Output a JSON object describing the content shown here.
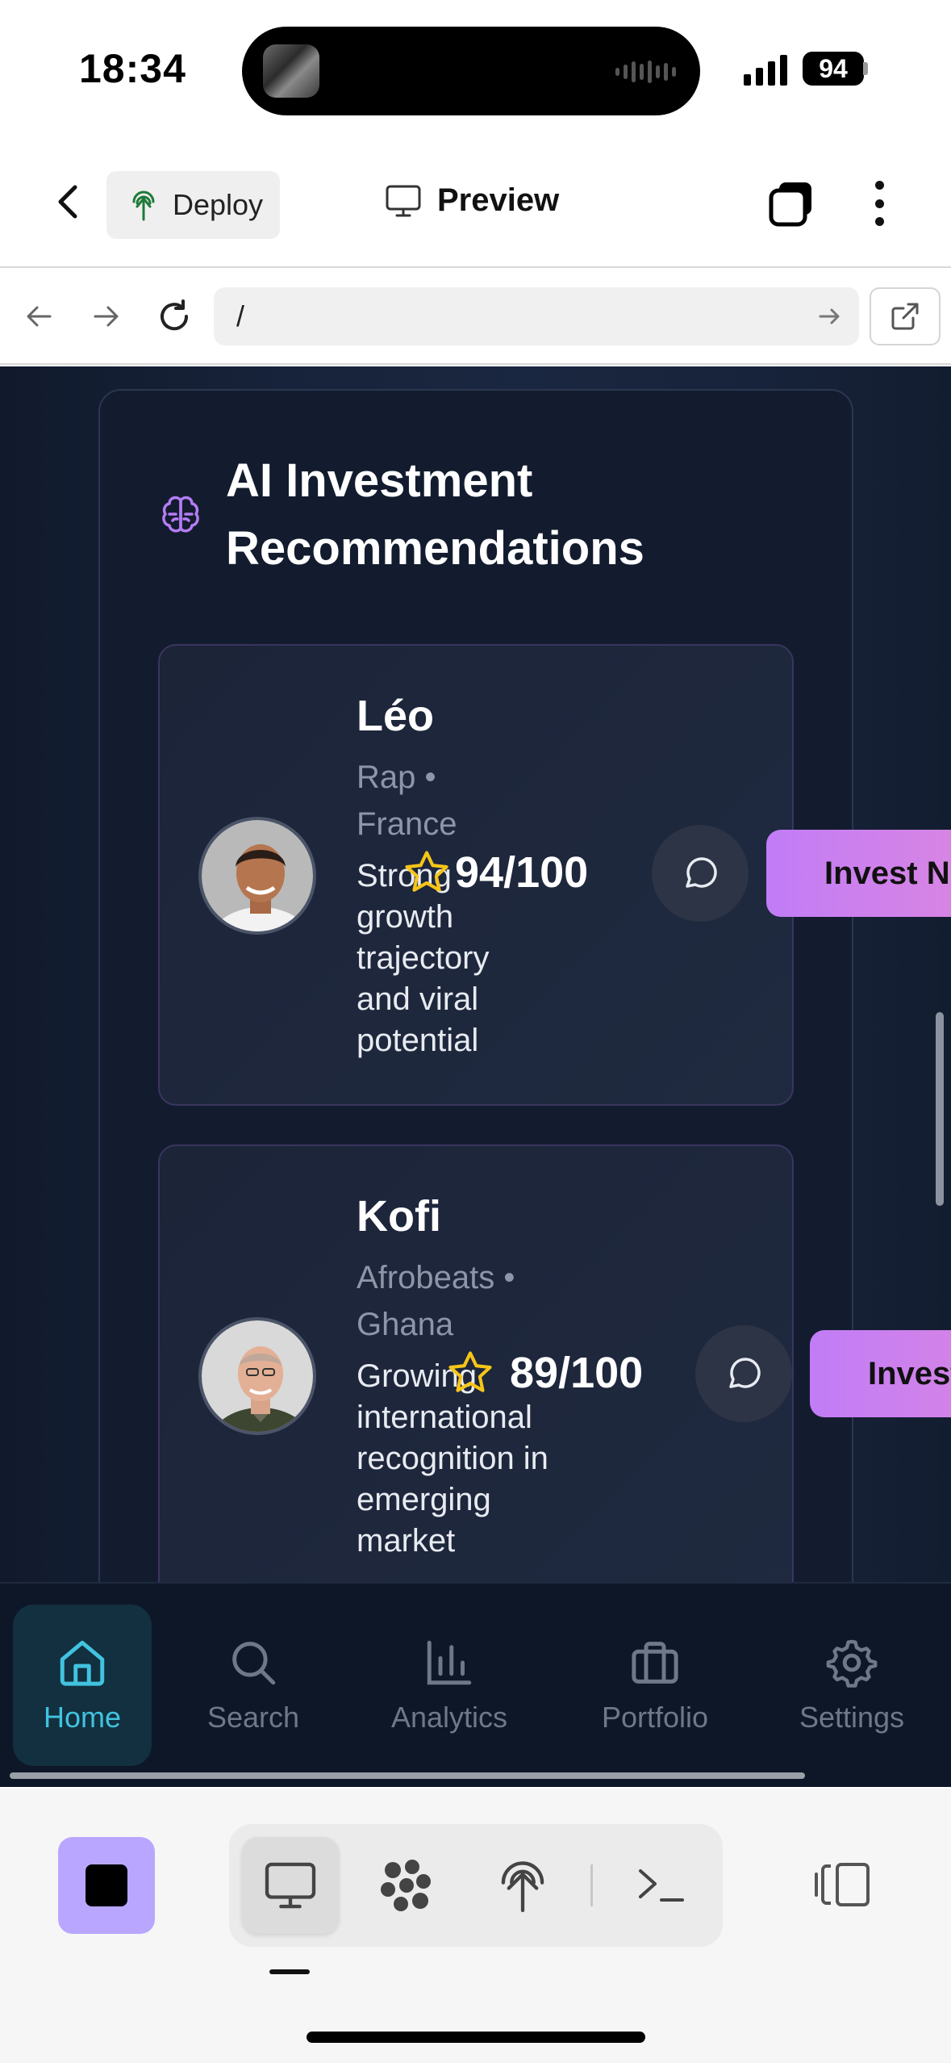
{
  "status_bar": {
    "time": "18:34",
    "battery": "94"
  },
  "header": {
    "deploy_label": "Deploy",
    "preview_label": "Preview"
  },
  "browser": {
    "url": "/"
  },
  "section": {
    "title": "AI Investment Recommendations"
  },
  "artists": [
    {
      "name": "Léo",
      "genre": "Rap •",
      "country": "France",
      "reason": "Strong growth trajectory and viral potential",
      "score": "94/100",
      "cta": "Invest Now"
    },
    {
      "name": "Kofi",
      "genre": "Afrobeats •",
      "country": "Ghana",
      "reason": "Growing international recognition in emerging market",
      "score": "89/100",
      "cta": "Invest Now"
    }
  ],
  "tabbar": {
    "items": [
      {
        "label": "Home",
        "icon": "home-icon",
        "active": true
      },
      {
        "label": "Search",
        "icon": "search-icon"
      },
      {
        "label": "Analytics",
        "icon": "bar-chart-icon"
      },
      {
        "label": "Portfolio",
        "icon": "briefcase-icon"
      },
      {
        "label": "Settings",
        "icon": "gear-icon"
      }
    ]
  },
  "colors": {
    "accent": "#41c3e0",
    "invest_gradient_start": "#c17cf6",
    "invest_gradient_end": "#e48ad9",
    "brain": "#b57cf5",
    "star": "#f5c518"
  }
}
